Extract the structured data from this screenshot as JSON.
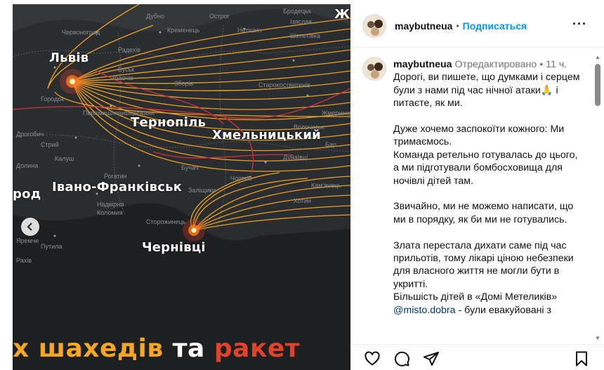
{
  "media": {
    "cities": [
      "Львів",
      "Тернопіль",
      "Хмельницький",
      "Івано-Франківськ",
      "Чернівці",
      "Ж",
      "род"
    ],
    "towns": [
      "Червоноград",
      "Дубно",
      "Кременець",
      "Острог",
      "Бродецьк",
      "Ізяслав",
      "Нетішин",
      "Шепетівка",
      "Радехів",
      "Буськ",
      "Золочів",
      "Зборів",
      "Старокостянтинів",
      "Городок",
      "Перемишляни",
      "Бережани",
      "Волочиськ",
      "Дунаївці",
      "Стрий",
      "Бучач",
      "Чортків",
      "Кам'янець",
      "Калуш",
      "Рогатин",
      "Заліщики",
      "Долина",
      "Надвірна",
      "Коломия",
      "Яремче",
      "Сторожинець",
      "Путила",
      "Рахів",
      "Хотин",
      "Бар",
      "Жмеринка",
      "Дрогобич"
    ],
    "caption": {
      "part1": "х шахедів",
      "part2": "та",
      "part3": "ракет"
    },
    "prev_icon": "chevron-left-icon"
  },
  "header": {
    "username": "maybutneua",
    "separator": "•",
    "follow_label": "Подписаться",
    "more_icon": "more-horizontal-icon",
    "more_label": "···"
  },
  "post": {
    "username": "maybutneua",
    "edited": "Отредактировано",
    "separator": "•",
    "time": "11 ч.",
    "lead": "Дорогі, ви пишете, що думками і серцем були з нами під час нічної атаки",
    "lead_emoji": "🙏",
    "lead_tail": " і питаєте, як ми.",
    "para2": "Дуже хочемо заспокоїти кожного: Ми тримаємось.",
    "para2b": "Команда ретельно готувалась до цього, а ми підготували бомбосховища для ночівлі дітей там.",
    "para3": "Звичайно, ми не можемо написати, що ми в порядку, як би ми не готувались.",
    "para4": "Злата перестала дихати саме під час прильотів, тому лікарі ціною небезпеки для власного життя не могли бути в укритті.",
    "para4b_pre": "Більшість дітей в «Домі Метеликів»",
    "mention": "@misto.dobra",
    "para4b_post": " - були евакуйовані з"
  },
  "actions": {
    "like_icon": "heart-icon",
    "comment_icon": "comment-icon",
    "share_icon": "share-icon",
    "save_icon": "bookmark-icon"
  },
  "colors": {
    "accent": "#0095f6",
    "trajectory": "#f5a623",
    "caption_red": "#e0432b",
    "map_bg": "#2a2d30"
  }
}
